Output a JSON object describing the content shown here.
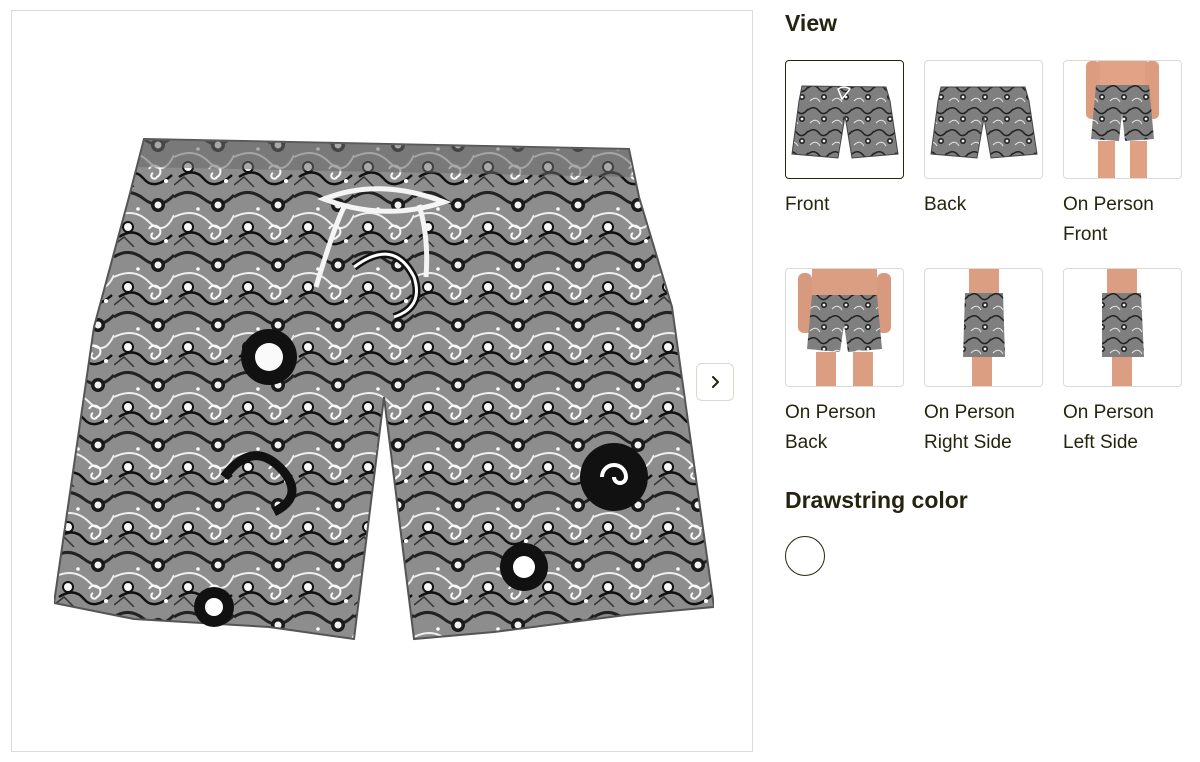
{
  "view_heading": "View",
  "views": [
    {
      "label": "Front",
      "selected": true,
      "icon": "shorts-front-image"
    },
    {
      "label": "Back",
      "selected": false,
      "icon": "shorts-back-image"
    },
    {
      "label": "On Person\nFront",
      "selected": false,
      "icon": "model-front-image"
    },
    {
      "label": "On Person\nBack",
      "selected": false,
      "icon": "model-back-image"
    },
    {
      "label": "On Person\nRight Side",
      "selected": false,
      "icon": "model-right-side-image"
    },
    {
      "label": "On Person\nLeft Side",
      "selected": false,
      "icon": "model-left-side-image"
    }
  ],
  "drawstring_heading": "Drawstring color",
  "drawstring_colors": [
    {
      "color": "#ffffff",
      "selected": true
    }
  ],
  "next_icon": "chevron-right-icon",
  "colors": {
    "text": "#24240f",
    "border": "#dcdcd4",
    "pattern_dark": "#1e1e1e",
    "pattern_light": "#c8c8c8"
  }
}
